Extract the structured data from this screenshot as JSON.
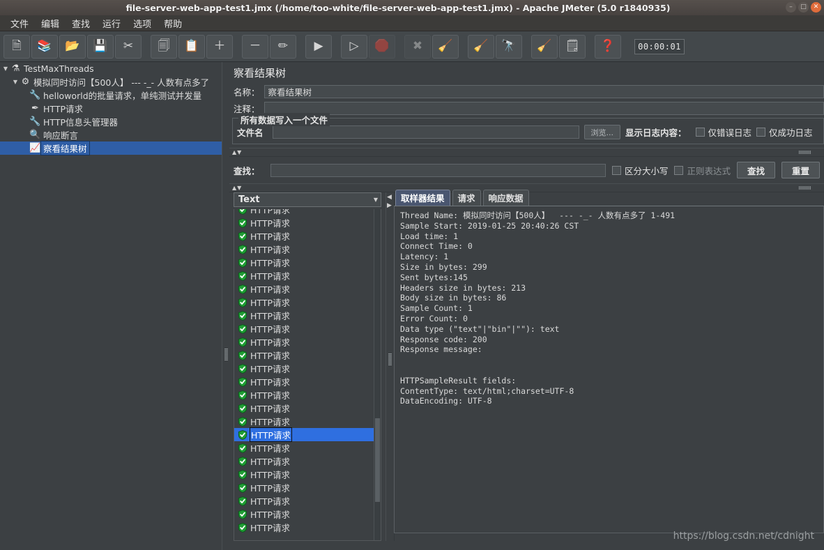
{
  "window": {
    "title": "file-server-web-app-test1.jmx (/home/too-white/file-server-web-app-test1.jmx) - Apache JMeter (5.0 r1840935)",
    "minimize": "–",
    "maximize": "□",
    "close": "✕"
  },
  "menubar": {
    "items": [
      {
        "label": "文件",
        "name": "menu-file"
      },
      {
        "label": "编辑",
        "name": "menu-edit"
      },
      {
        "label": "查找",
        "name": "menu-search"
      },
      {
        "label": "运行",
        "name": "menu-run"
      },
      {
        "label": "选项",
        "name": "menu-options"
      },
      {
        "label": "帮助",
        "name": "menu-help"
      }
    ]
  },
  "toolbar": {
    "buttons": [
      {
        "name": "new-button",
        "icon": "new-file-icon",
        "glyph": "🗎"
      },
      {
        "name": "templates-button",
        "icon": "templates-icon",
        "glyph": "📚"
      },
      {
        "name": "open-button",
        "icon": "open-folder-icon",
        "glyph": "📂"
      },
      {
        "name": "save-button",
        "icon": "save-disk-icon",
        "glyph": "💾"
      },
      {
        "name": "cut-button",
        "icon": "scissors-icon",
        "glyph": "✂"
      },
      {
        "name": "copy-button",
        "icon": "copy-icon",
        "glyph": "🗐"
      },
      {
        "name": "paste-button",
        "icon": "clipboard-icon",
        "glyph": "📋"
      },
      {
        "name": "expand-all-button",
        "icon": "plus-icon",
        "glyph": "＋"
      },
      {
        "name": "collapse-all-button",
        "icon": "minus-icon",
        "glyph": "－"
      },
      {
        "name": "toggle-button",
        "icon": "toggle-pencil-icon",
        "glyph": "✏"
      },
      {
        "name": "start-button",
        "icon": "play-green-icon",
        "glyph": "▶"
      },
      {
        "name": "start-no-pauses-button",
        "icon": "play-no-pause-icon",
        "glyph": "▷"
      },
      {
        "name": "stop-button",
        "icon": "stop-sign-icon",
        "glyph": "🛑"
      },
      {
        "name": "shutdown-button",
        "icon": "shutdown-x-icon",
        "glyph": "✖"
      },
      {
        "name": "clear-button",
        "icon": "gear-broom-icon",
        "glyph": "🧹"
      },
      {
        "name": "clear-all-button",
        "icon": "gears-broom-icon",
        "glyph": "🧹"
      },
      {
        "name": "search-button",
        "icon": "binoculars-icon",
        "glyph": "🔭"
      },
      {
        "name": "reset-search-button",
        "icon": "broom-icon",
        "glyph": "🧹"
      },
      {
        "name": "function-helper-button",
        "icon": "notes-icon",
        "glyph": "🗒"
      },
      {
        "name": "help-button",
        "icon": "help-book-icon",
        "glyph": "❓"
      }
    ],
    "elapsed": "00:00:01"
  },
  "tree": {
    "nodes": [
      {
        "name": "tree-node-test-plan",
        "label": "TestMaxThreads",
        "icon": "test-plan-icon",
        "glyph": "⚗",
        "depth": 0,
        "toggle": "▼",
        "selected": false
      },
      {
        "name": "tree-node-thread-group",
        "label": "模拟同时访问【500人】  --- -_- 人数有点多了",
        "icon": "thread-group-icon",
        "glyph": "⚙",
        "depth": 1,
        "toggle": "▼",
        "selected": false
      },
      {
        "name": "tree-node-config-element",
        "label": "helloworld的批量请求，单纯测试并发量",
        "icon": "config-element-icon",
        "glyph": "🔧",
        "depth": 2,
        "toggle": "",
        "selected": false
      },
      {
        "name": "tree-node-http-request",
        "label": "HTTP请求",
        "icon": "http-sampler-icon",
        "glyph": "✒",
        "depth": 2,
        "toggle": "",
        "selected": false
      },
      {
        "name": "tree-node-http-header-manager",
        "label": "HTTP信息头管理器",
        "icon": "header-manager-icon",
        "glyph": "🔧",
        "depth": 2,
        "toggle": "",
        "selected": false
      },
      {
        "name": "tree-node-response-assertion",
        "label": "响应断言",
        "icon": "assertion-magnifier-icon",
        "glyph": "🔍",
        "depth": 2,
        "toggle": "",
        "selected": false
      },
      {
        "name": "tree-node-view-results-tree",
        "label": "察看结果树",
        "icon": "view-results-tree-icon",
        "glyph": "📈",
        "depth": 2,
        "toggle": "",
        "selected": true
      }
    ]
  },
  "panel": {
    "title": "察看结果树",
    "name_label": "名称：",
    "name_value": "察看结果树",
    "comment_label": "注释：",
    "comment_value": "",
    "group_title": "所有数据写入一个文件",
    "filename_label": "文件名",
    "filename_value": "",
    "browse_label": "浏览...",
    "log_display_label": "显示日志内容：",
    "errors_only_label": "仅错误日志",
    "success_only_label": "仅成功日志",
    "errors_only_checked": false,
    "success_only_checked": false
  },
  "search": {
    "label": "查找：",
    "value": "",
    "case_sensitive_label": "区分大小写",
    "regex_label": "正则表达式",
    "case_sensitive_checked": false,
    "regex_checked": false,
    "find_button": "查找",
    "reset_button": "重置"
  },
  "renderer": {
    "selected": "Text",
    "arrow": "▼"
  },
  "results_list": {
    "item_label": "HTTP请求",
    "count": 25,
    "selected_index": 17,
    "status_icon": "green-check-shield-icon"
  },
  "tabs": [
    {
      "name": "tab-sampler-result",
      "label": "取样器结果",
      "active": true
    },
    {
      "name": "tab-request",
      "label": "请求",
      "active": false
    },
    {
      "name": "tab-response-data",
      "label": "响应数据",
      "active": false
    }
  ],
  "detail": {
    "text": "Thread Name: 模拟同时访问【500人】  --- -_- 人数有点多了 1-491\nSample Start: 2019-01-25 20:40:26 CST\nLoad time: 1\nConnect Time: 0\nLatency: 1\nSize in bytes: 299\nSent bytes:145\nHeaders size in bytes: 213\nBody size in bytes: 86\nSample Count: 1\nError Count: 0\nData type (\"text\"|\"bin\"|\"\"): text\nResponse code: 200\nResponse message: \n\n\nHTTPSampleResult fields:\nContentType: text/html;charset=UTF-8\nDataEncoding: UTF-8"
  },
  "watermark": "https://blog.csdn.net/cdnight"
}
